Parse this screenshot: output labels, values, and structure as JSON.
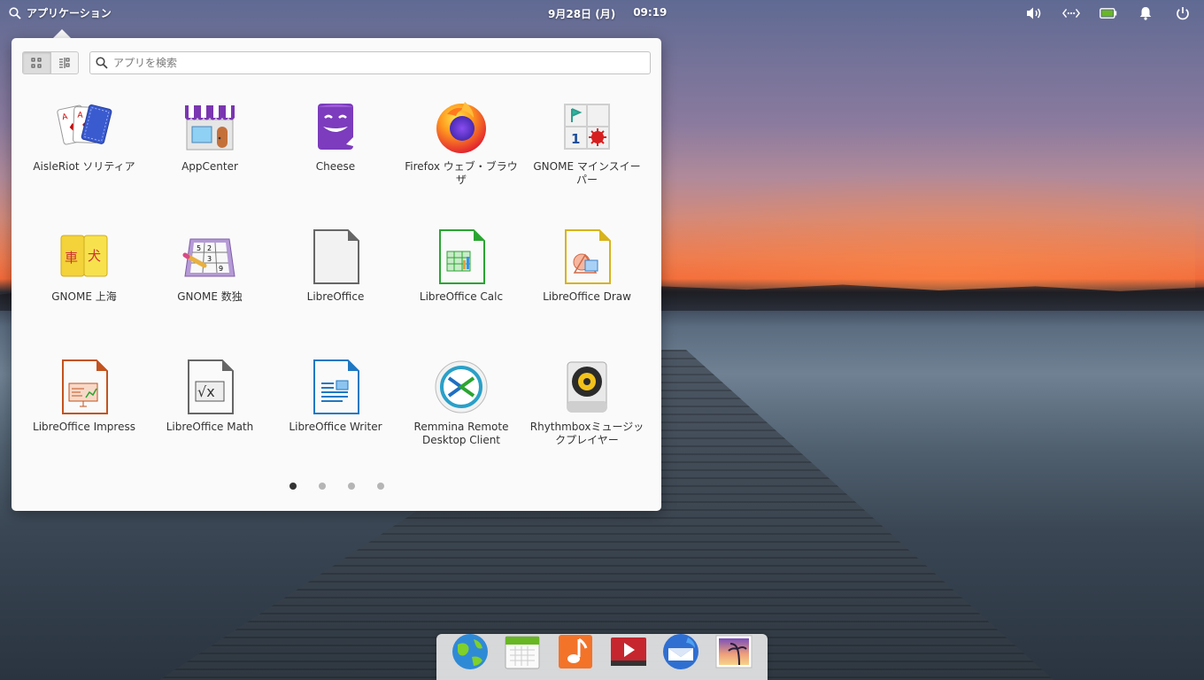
{
  "panel": {
    "applications_label": "アプリケーション",
    "date": "9月28日 (月)",
    "time": "09:19"
  },
  "indicators": [
    "volume-icon",
    "network-icon",
    "battery-icon",
    "notifications-icon",
    "power-icon"
  ],
  "launcher": {
    "search_placeholder": "アプリを検索",
    "view_modes": [
      "grid-view",
      "category-view"
    ],
    "apps": [
      [
        {
          "label": "AisleRiot ソリティア",
          "icon": "solitaire-icon"
        },
        {
          "label": "AppCenter",
          "icon": "appcenter-icon"
        },
        {
          "label": "Cheese",
          "icon": "cheese-icon"
        },
        {
          "label": "Firefox ウェブ・ブラウザ",
          "icon": "firefox-icon"
        },
        {
          "label": "GNOME マインスイーパー",
          "icon": "mines-icon"
        }
      ],
      [
        {
          "label": "GNOME 上海",
          "icon": "mahjongg-icon"
        },
        {
          "label": "GNOME 数独",
          "icon": "sudoku-icon"
        },
        {
          "label": "LibreOffice",
          "icon": "libreoffice-icon"
        },
        {
          "label": "LibreOffice Calc",
          "icon": "libreoffice-calc-icon"
        },
        {
          "label": "LibreOffice Draw",
          "icon": "libreoffice-draw-icon"
        }
      ],
      [
        {
          "label": "LibreOffice Impress",
          "icon": "libreoffice-impress-icon"
        },
        {
          "label": "LibreOffice Math",
          "icon": "libreoffice-math-icon"
        },
        {
          "label": "LibreOffice Writer",
          "icon": "libreoffice-writer-icon"
        },
        {
          "label": "Remmina Remote Desktop Client",
          "icon": "remmina-icon"
        },
        {
          "label": "Rhythmboxミュージックプレイヤー",
          "icon": "rhythmbox-icon"
        }
      ]
    ],
    "pages": 4,
    "current_page": 1
  },
  "dock": [
    "web-browser-icon",
    "calendar-icon",
    "music-icon",
    "videos-icon",
    "mail-icon",
    "photos-icon"
  ],
  "colors": {
    "accent_blue": "#3689e6",
    "panel_text": "#ffffff",
    "launcher_bg": "#fafafa"
  }
}
